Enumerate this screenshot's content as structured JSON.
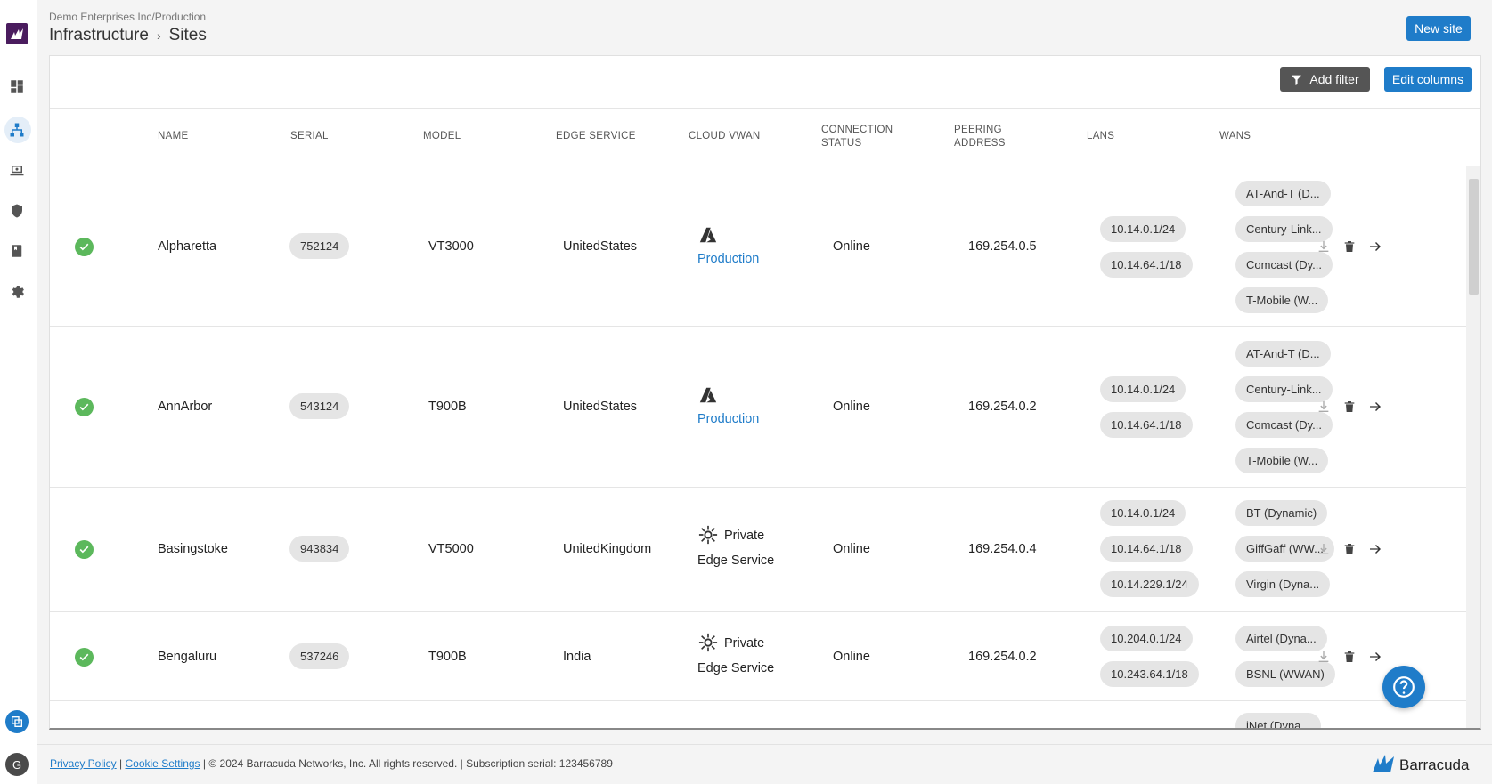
{
  "header": {
    "org_path": "Demo Enterprises Inc/Production",
    "breadcrumb_parent": "Infrastructure",
    "breadcrumb_sep": "›",
    "breadcrumb_current": "Sites",
    "new_site_label": "New site"
  },
  "toolbar": {
    "add_filter_label": "Add filter",
    "edit_columns_label": "Edit columns"
  },
  "columns": {
    "name": "NAME",
    "serial": "SERIAL",
    "model": "MODEL",
    "edge_service": "EDGE SERVICE",
    "cloud_vwan": "CLOUD VWAN",
    "connection_status": "CONNECTION STATUS",
    "peering_address": "PEERING ADDRESS",
    "lans": "LANS",
    "wans": "WANS"
  },
  "rows": [
    {
      "name": "Alpharetta",
      "serial": "752124",
      "model": "VT3000",
      "edge_service": "UnitedStates",
      "cloud_vwan": "Production",
      "cloud_vwan_type": "azure",
      "connection_status": "Online",
      "peering_address": "169.254.0.5",
      "lans": [
        "10.14.0.1/24",
        "10.14.64.1/18"
      ],
      "wans": [
        "AT-And-T (D...",
        "Century-Link...",
        "Comcast (Dy...",
        "T-Mobile (W..."
      ]
    },
    {
      "name": "AnnArbor",
      "serial": "543124",
      "model": "T900B",
      "edge_service": "UnitedStates",
      "cloud_vwan": "Production",
      "cloud_vwan_type": "azure",
      "connection_status": "Online",
      "peering_address": "169.254.0.2",
      "lans": [
        "10.14.0.1/24",
        "10.14.64.1/18"
      ],
      "wans": [
        "AT-And-T (D...",
        "Century-Link...",
        "Comcast (Dy...",
        "T-Mobile (W..."
      ]
    },
    {
      "name": "Basingstoke",
      "serial": "943834",
      "model": "VT5000",
      "edge_service": "UnitedKingdom",
      "cloud_vwan_line1": "Private",
      "cloud_vwan_line2": "Edge Service",
      "cloud_vwan_type": "private",
      "connection_status": "Online",
      "peering_address": "169.254.0.4",
      "lans": [
        "10.14.0.1/24",
        "10.14.64.1/18",
        "10.14.229.1/24"
      ],
      "wans": [
        "BT (Dynamic)",
        "GiffGaff (WW...",
        "Virgin (Dyna..."
      ]
    },
    {
      "name": "Bengaluru",
      "serial": "537246",
      "model": "T900B",
      "edge_service": "India",
      "cloud_vwan_line1": "Private",
      "cloud_vwan_line2": "Edge Service",
      "cloud_vwan_type": "private",
      "connection_status": "Online",
      "peering_address": "169.254.0.2",
      "lans": [
        "10.204.0.1/24",
        "10.243.64.1/18"
      ],
      "wans": [
        "Airtel (Dyna...",
        "BSNL (WWAN)"
      ]
    }
  ],
  "partial_row": {
    "wan": "iNet (Dyna..."
  },
  "footer": {
    "privacy": "Privacy Policy",
    "sep": "|",
    "cookie": "Cookie Settings",
    "copyright": "| © 2024 Barracuda Networks, Inc. All rights reserved. | Subscription serial: 123456789",
    "brand": "Barracuda"
  },
  "user": {
    "initial": "G"
  },
  "colors": {
    "accent": "#1f7cc9",
    "status_ok": "#5cb85c",
    "chip_bg": "#e5e5e5",
    "brand": "#4a1c5e"
  }
}
